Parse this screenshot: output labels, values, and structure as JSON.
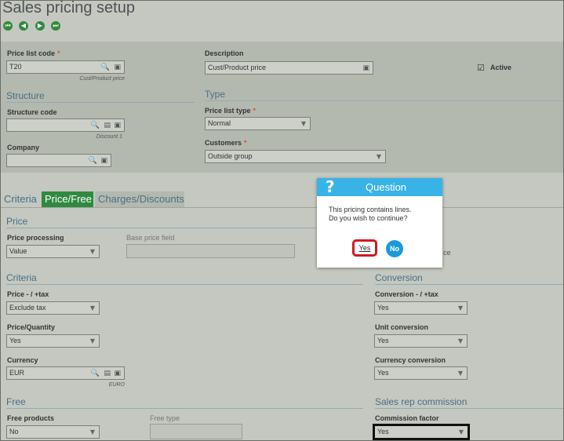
{
  "window": {
    "title": "Sales pricing setup"
  },
  "nav": {
    "first": "⏮",
    "prev": "◀",
    "next": "▶",
    "last": "⏭"
  },
  "header": {
    "price_list_code": {
      "label": "Price list code",
      "value": "T20",
      "sub": "Cust/Product price"
    },
    "description": {
      "label": "Description",
      "value": "Cust/Product price"
    },
    "active": {
      "label": "Active",
      "checked": true
    },
    "structure_section": "Structure",
    "type_section": "Type",
    "structure_code": {
      "label": "Structure code",
      "value": "",
      "sub": "Discount 1"
    },
    "price_list_type": {
      "label": "Price list type",
      "value": "Normal"
    },
    "company": {
      "label": "Company",
      "value": ""
    },
    "customers": {
      "label": "Customers",
      "value": "Outside group"
    }
  },
  "tabs": [
    {
      "label": "Criteria"
    },
    {
      "label": "Price/Free"
    },
    {
      "label": "Charges/Discounts"
    }
  ],
  "price_section": {
    "title": "Price",
    "price_processing": {
      "label": "Price processing",
      "value": "Value"
    },
    "base_price_field": {
      "label": "Base price field",
      "value": ""
    }
  },
  "criteria_section": {
    "title": "Criteria",
    "price_tax": {
      "label": "Price - / +tax",
      "value": "Exclude tax"
    },
    "price_quantity": {
      "label": "Price/Quantity",
      "value": "Yes"
    },
    "currency": {
      "label": "Currency",
      "value": "EUR",
      "sub": "EURO"
    }
  },
  "conversion_section": {
    "title": "Conversion",
    "conversion_tax": {
      "label": "Conversion - / +tax",
      "value": "Yes"
    },
    "unit_conversion": {
      "label": "Unit conversion",
      "value": "Yes"
    },
    "currency_conversion": {
      "label": "Currency conversion",
      "value": "Yes"
    }
  },
  "free_section": {
    "title": "Free",
    "free_products": {
      "label": "Free products",
      "value": "No"
    },
    "free_type": {
      "label": "Free type",
      "value": ""
    }
  },
  "commission_section": {
    "title": "Sales rep commission",
    "commission_factor": {
      "label": "Commission factor",
      "value": "Yes"
    }
  },
  "partial_text": "ce",
  "dialog": {
    "title": "Question",
    "icon": "?",
    "message_line1": "This pricing contains lines.",
    "message_line2": "Do you wish to continue?",
    "yes": "Yes",
    "no": "No"
  }
}
